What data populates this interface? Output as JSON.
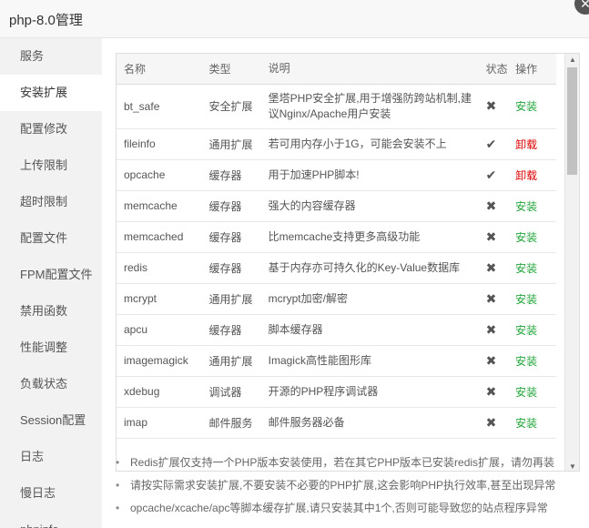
{
  "window": {
    "title": "php-8.0管理",
    "close_symbol": "✕"
  },
  "sidebar": {
    "items": [
      {
        "label": "服务",
        "active": false
      },
      {
        "label": "安装扩展",
        "active": true
      },
      {
        "label": "配置修改",
        "active": false
      },
      {
        "label": "上传限制",
        "active": false
      },
      {
        "label": "超时限制",
        "active": false
      },
      {
        "label": "配置文件",
        "active": false
      },
      {
        "label": "FPM配置文件",
        "active": false
      },
      {
        "label": "禁用函数",
        "active": false
      },
      {
        "label": "性能调整",
        "active": false
      },
      {
        "label": "负载状态",
        "active": false
      },
      {
        "label": "Session配置",
        "active": false
      },
      {
        "label": "日志",
        "active": false
      },
      {
        "label": "慢日志",
        "active": false
      },
      {
        "label": "phpinfo",
        "active": false
      }
    ]
  },
  "table": {
    "headers": {
      "name": "名称",
      "type": "类型",
      "desc": "说明",
      "status": "状态",
      "op": "操作"
    },
    "rows": [
      {
        "name": "bt_safe",
        "type": "安全扩展",
        "desc": "堡塔PHP安全扩展,用于增强防跨站机制,建议Nginx/Apache用户安装",
        "status": "✖",
        "op": "安装",
        "installed": false
      },
      {
        "name": "fileinfo",
        "type": "通用扩展",
        "desc": "若可用内存小于1G，可能会安装不上",
        "status": "✔",
        "op": "卸载",
        "installed": true
      },
      {
        "name": "opcache",
        "type": "缓存器",
        "desc": "用于加速PHP脚本!",
        "status": "✔",
        "op": "卸载",
        "installed": true
      },
      {
        "name": "memcache",
        "type": "缓存器",
        "desc": "强大的内容缓存器",
        "status": "✖",
        "op": "安装",
        "installed": false
      },
      {
        "name": "memcached",
        "type": "缓存器",
        "desc": "比memcache支持更多高级功能",
        "status": "✖",
        "op": "安装",
        "installed": false
      },
      {
        "name": "redis",
        "type": "缓存器",
        "desc": "基于内存亦可持久化的Key-Value数据库",
        "status": "✖",
        "op": "安装",
        "installed": false
      },
      {
        "name": "mcrypt",
        "type": "通用扩展",
        "desc": "mcrypt加密/解密",
        "status": "✖",
        "op": "安装",
        "installed": false
      },
      {
        "name": "apcu",
        "type": "缓存器",
        "desc": "脚本缓存器",
        "status": "✖",
        "op": "安装",
        "installed": false
      },
      {
        "name": "imagemagick",
        "type": "通用扩展",
        "desc": "Imagick高性能图形库",
        "status": "✖",
        "op": "安装",
        "installed": false
      },
      {
        "name": "xdebug",
        "type": "调试器",
        "desc": "开源的PHP程序调试器",
        "status": "✖",
        "op": "安装",
        "installed": false
      },
      {
        "name": "imap",
        "type": "邮件服务",
        "desc": "邮件服务器必备",
        "status": "✖",
        "op": "安装",
        "installed": false
      }
    ]
  },
  "scroll": {
    "up": "▲",
    "down": "▼"
  },
  "notes": [
    "Redis扩展仅支持一个PHP版本安装使用，若在其它PHP版本已安装redis扩展，请勿再装",
    "请按实际需求安装扩展,不要安装不必要的PHP扩展,这会影响PHP执行效率,甚至出现异常",
    "opcache/xcache/apc等脚本缓存扩展,请只安装其中1个,否则可能导致您的站点程序异常"
  ]
}
